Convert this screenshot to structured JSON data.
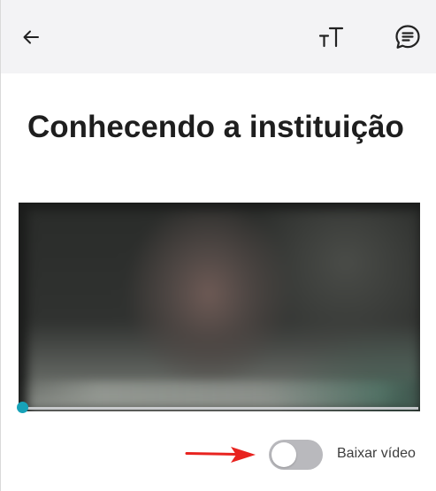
{
  "header": {
    "back_icon": "arrow-left-icon",
    "text_size_icon": "text-size-icon",
    "comments_icon": "chat-bubble-icon"
  },
  "lesson": {
    "title": "Conhecendo a instituição"
  },
  "video": {
    "progress": 0.0,
    "accent_color": "#17a2b8"
  },
  "download": {
    "label": "Baixar vídeo",
    "enabled": false,
    "annotation": "red-arrow-icon"
  }
}
